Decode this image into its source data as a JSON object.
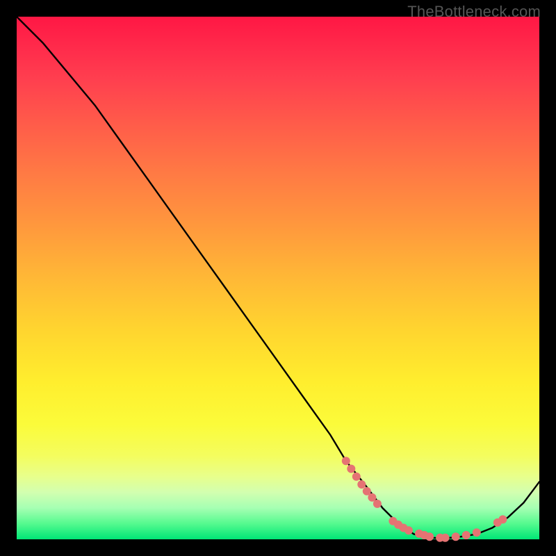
{
  "watermark": "TheBottleneck.com",
  "chart_data": {
    "type": "line",
    "title": "",
    "xlabel": "",
    "ylabel": "",
    "xlim": [
      0,
      100
    ],
    "ylim": [
      0,
      100
    ],
    "grid": false,
    "legend": false,
    "background_gradient": {
      "direction": "vertical",
      "stops": [
        {
          "pos": 0.0,
          "color": "#ff1744"
        },
        {
          "pos": 0.5,
          "color": "#ffd52f"
        },
        {
          "pos": 0.85,
          "color": "#f4fd5e"
        },
        {
          "pos": 1.0,
          "color": "#00e676"
        }
      ]
    },
    "series": [
      {
        "name": "bottleneck-curve",
        "color": "#000000",
        "x": [
          0,
          5,
          10,
          15,
          20,
          25,
          30,
          35,
          40,
          45,
          50,
          55,
          60,
          63,
          67,
          70,
          73,
          76,
          79,
          82,
          85,
          88,
          91,
          94,
          97,
          100
        ],
        "y": [
          100,
          95,
          89,
          83,
          76,
          69,
          62,
          55,
          48,
          41,
          34,
          27,
          20,
          15,
          10,
          6,
          3,
          1,
          0.3,
          0.2,
          0.5,
          1.0,
          2.2,
          4.2,
          7.0,
          11
        ]
      }
    ],
    "scatter_points": {
      "name": "highlight-points",
      "color": "#e57373",
      "radius": 6,
      "points": [
        {
          "x": 63,
          "y": 15
        },
        {
          "x": 64,
          "y": 13.5
        },
        {
          "x": 65,
          "y": 12
        },
        {
          "x": 66,
          "y": 10.5
        },
        {
          "x": 67,
          "y": 9.2
        },
        {
          "x": 68,
          "y": 8
        },
        {
          "x": 69,
          "y": 6.8
        },
        {
          "x": 72,
          "y": 3.5
        },
        {
          "x": 73,
          "y": 2.8
        },
        {
          "x": 74,
          "y": 2.2
        },
        {
          "x": 75,
          "y": 1.7
        },
        {
          "x": 77,
          "y": 1.1
        },
        {
          "x": 78,
          "y": 0.8
        },
        {
          "x": 79,
          "y": 0.5
        },
        {
          "x": 81,
          "y": 0.3
        },
        {
          "x": 82,
          "y": 0.3
        },
        {
          "x": 84,
          "y": 0.5
        },
        {
          "x": 86,
          "y": 0.8
        },
        {
          "x": 88,
          "y": 1.3
        },
        {
          "x": 92,
          "y": 3.2
        },
        {
          "x": 93,
          "y": 3.8
        }
      ]
    }
  }
}
